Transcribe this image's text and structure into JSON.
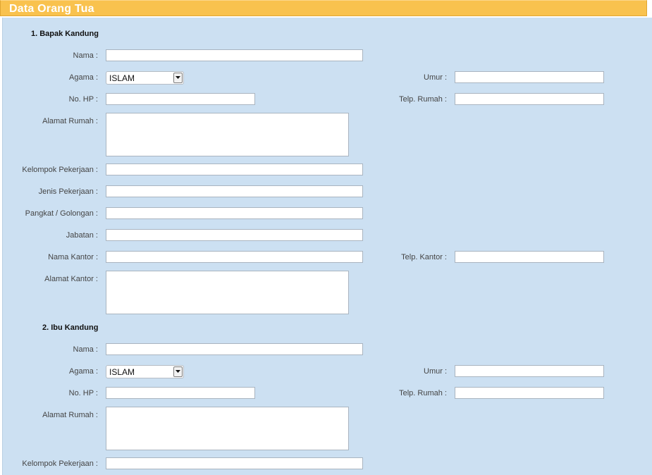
{
  "header": {
    "title": "Data Orang Tua"
  },
  "father": {
    "heading": "1. Bapak Kandung",
    "nama_label": "Nama :",
    "agama_label": "Agama :",
    "agama_value": "ISLAM",
    "umur_label": "Umur :",
    "hp_label": "No. HP :",
    "telp_rumah_label": "Telp. Rumah :",
    "alamat_rumah_label": "Alamat Rumah :",
    "kelompok_label": "Kelompok Pekerjaan :",
    "jenis_label": "Jenis Pekerjaan :",
    "pangkat_label": "Pangkat / Golongan :",
    "jabatan_label": "Jabatan :",
    "nama_kantor_label": "Nama Kantor :",
    "telp_kantor_label": "Telp. Kantor :",
    "alamat_kantor_label": "Alamat Kantor :"
  },
  "mother": {
    "heading": "2. Ibu Kandung",
    "nama_label": "Nama :",
    "agama_label": "Agama :",
    "agama_value": "ISLAM",
    "umur_label": "Umur :",
    "hp_label": "No. HP :",
    "telp_rumah_label": "Telp. Rumah :",
    "alamat_rumah_label": "Alamat Rumah :",
    "kelompok_label": "Kelompok Pekerjaan :"
  },
  "icons": {
    "select_arrow": "chevron-down-icon"
  }
}
